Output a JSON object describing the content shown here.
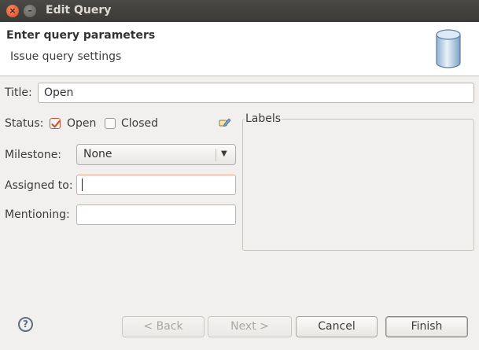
{
  "window": {
    "title": "Edit Query",
    "close_glyph": "×",
    "minimize_glyph": "–"
  },
  "banner": {
    "title": "Enter query parameters",
    "subtitle": "Issue query settings",
    "icon": "database-icon"
  },
  "form": {
    "title_label": "Title:",
    "title_value": "Open",
    "status_label": "Status:",
    "status_open_label": "Open",
    "status_open_checked": true,
    "status_closed_label": "Closed",
    "status_closed_checked": false,
    "edit_icon": "edit-labels-icon",
    "milestone_label": "Milestone:",
    "milestone_value": "None",
    "assigned_label": "Assigned to:",
    "assigned_value": "",
    "mentioning_label": "Mentioning:",
    "mentioning_value": "",
    "labels_group_title": "Labels"
  },
  "buttons": {
    "help_glyph": "?",
    "back": "< Back",
    "next": "Next >",
    "cancel": "Cancel",
    "finish": "Finish"
  },
  "colors": {
    "accent_check": "#c9573a",
    "focus_border": "#e8a48c",
    "titlebar": "#3b3a36"
  }
}
